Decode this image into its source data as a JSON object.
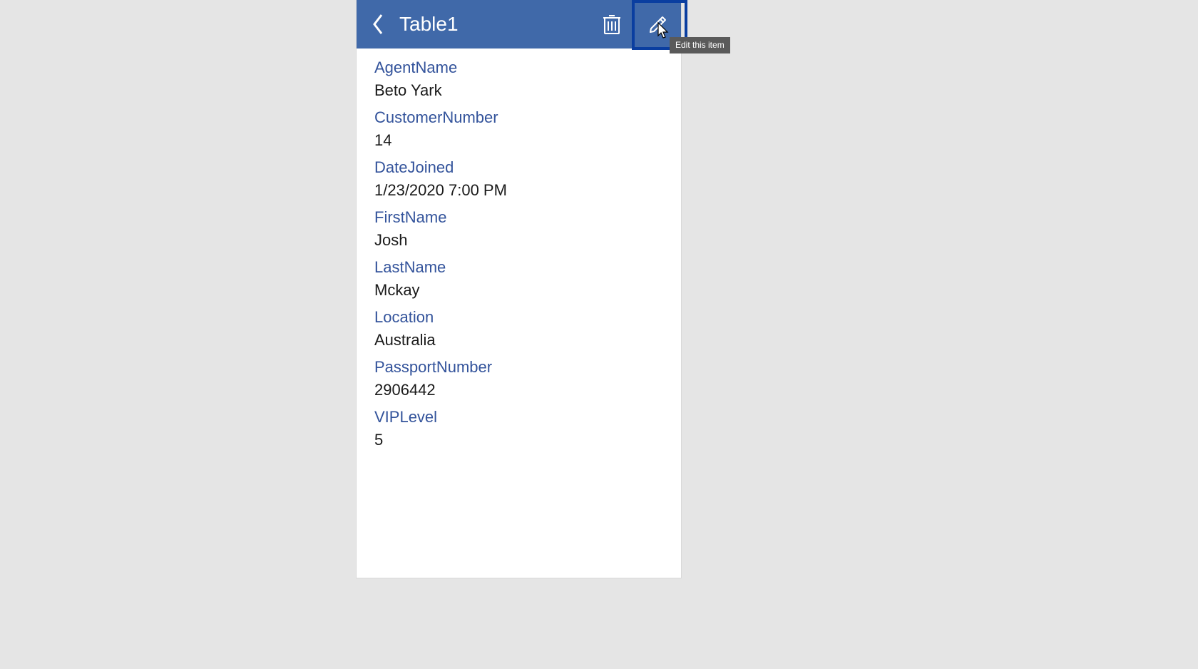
{
  "header": {
    "title": "Table1",
    "tooltip": "Edit this item"
  },
  "fields": [
    {
      "label": "AgentName",
      "value": "Beto Yark"
    },
    {
      "label": "CustomerNumber",
      "value": "14"
    },
    {
      "label": "DateJoined",
      "value": "1/23/2020 7:00 PM"
    },
    {
      "label": "FirstName",
      "value": "Josh"
    },
    {
      "label": "LastName",
      "value": "Mckay"
    },
    {
      "label": "Location",
      "value": "Australia"
    },
    {
      "label": "PassportNumber",
      "value": "2906442"
    },
    {
      "label": "VIPLevel",
      "value": "5"
    }
  ]
}
